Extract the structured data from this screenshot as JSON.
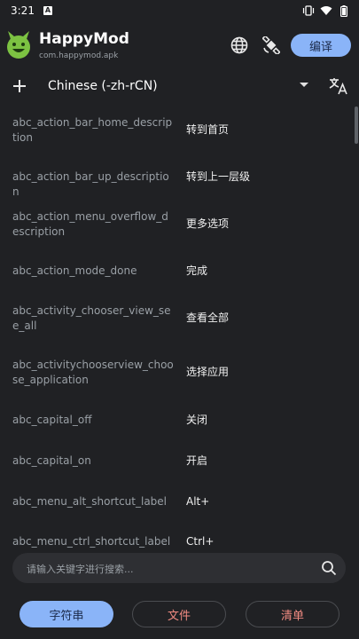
{
  "status_bar": {
    "time": "3:21",
    "notification_badge": "A"
  },
  "app": {
    "title": "HappyMod",
    "package": "com.happymod.apk"
  },
  "toolbar": {
    "translate_label": "编译"
  },
  "language": {
    "selected": "Chinese (-zh-rCN)"
  },
  "rows": [
    {
      "key": "abc_action_bar_home_description",
      "value": "转到首页"
    },
    {
      "key": "abc_action_bar_up_description",
      "value": "转到上一层级"
    },
    {
      "key": "abc_action_menu_overflow_description",
      "value": "更多选项"
    },
    {
      "key": "abc_action_mode_done",
      "value": "完成"
    },
    {
      "key": "abc_activity_chooser_view_see_all",
      "value": "查看全部"
    },
    {
      "key": "abc_activitychooserview_choose_application",
      "value": "选择应用"
    },
    {
      "key": "abc_capital_off",
      "value": "关闭"
    },
    {
      "key": "abc_capital_on",
      "value": "开启"
    },
    {
      "key": "abc_menu_alt_shortcut_label",
      "value": "Alt+"
    },
    {
      "key": "abc_menu_ctrl_shortcut_label",
      "value": "Ctrl+"
    }
  ],
  "search": {
    "placeholder": "请输入关键字进行搜索...",
    "value": ""
  },
  "bottom_tabs": {
    "strings": "字符串",
    "files": "文件",
    "list": "清单"
  },
  "colors": {
    "background": "#202124",
    "accent": "#8ab4f8",
    "danger_text": "#f28b82",
    "logo": "#7cc242"
  }
}
